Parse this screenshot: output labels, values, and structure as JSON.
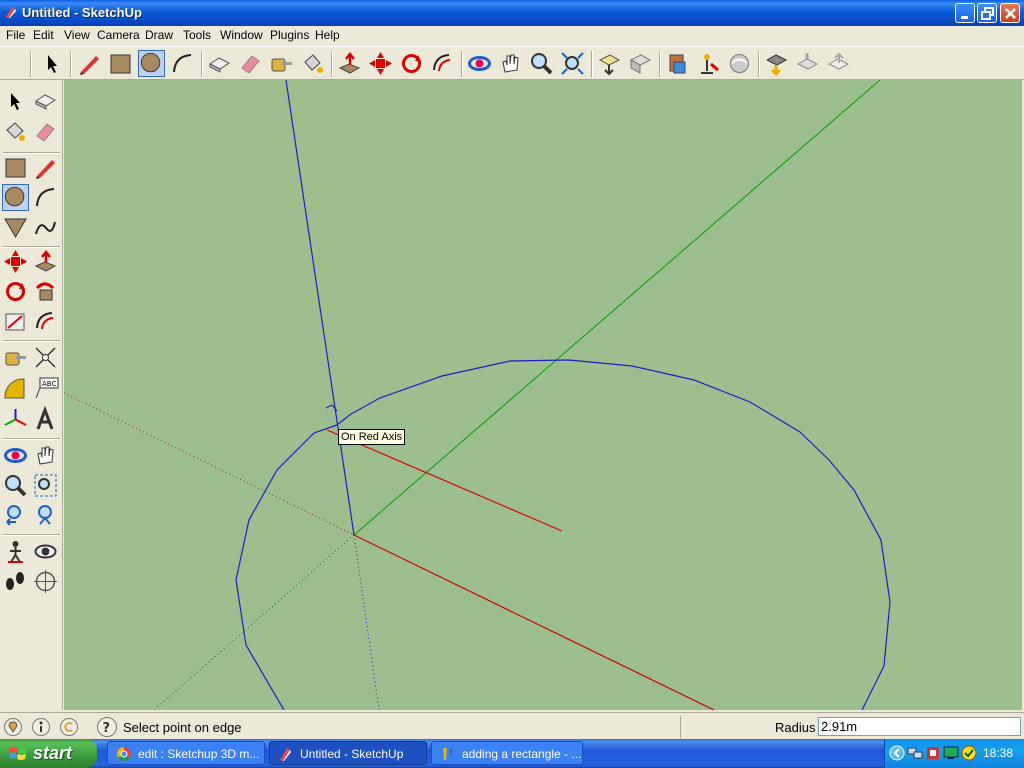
{
  "window": {
    "title": "Untitled - SketchUp",
    "controls": [
      "minimize-icon",
      "maximize-icon",
      "close-icon"
    ]
  },
  "menu": [
    "File",
    "Edit",
    "View",
    "Camera",
    "Draw",
    "Tools",
    "Window",
    "Plugins",
    "Help"
  ],
  "toolbar": {
    "tools": [
      "select-icon",
      "pencil-icon",
      "rectangle-icon",
      "circle-icon",
      "arc-icon",
      "make-component-icon",
      "eraser-icon",
      "tape-measure-icon",
      "paint-bucket-icon",
      "push-pull-icon",
      "move-icon",
      "rotate-icon",
      "offset-icon",
      "orbit-icon",
      "pan-icon",
      "zoom-icon",
      "zoom-extents-icon",
      "previous-view-icon",
      "next-view-icon",
      "3d-warehouse-icon",
      "get-models-icon",
      "share-model-icon",
      "share-component-icon",
      "photo-textures-icon",
      "google-earth-icon"
    ],
    "active": "circle-icon"
  },
  "viewport": {
    "tooltip": "On Red Axis",
    "background": "#9cbf8e",
    "axis_colors": {
      "red": "#e00000",
      "green": "#00b000",
      "blue": "#0000c8"
    }
  },
  "status": {
    "text": "Select point on edge",
    "vcb_label": "Radius",
    "vcb_value": "2.91m"
  },
  "taskbar": {
    "start_label": "start",
    "tasks": [
      {
        "label": "edit : Sketchup 3D m...",
        "icon": "chrome-icon"
      },
      {
        "label": "Untitled - SketchUp",
        "icon": "sketchup-icon",
        "active": true
      },
      {
        "label": "adding a rectangle - ...",
        "icon": "paint-icon"
      }
    ],
    "clock": "18:38"
  }
}
